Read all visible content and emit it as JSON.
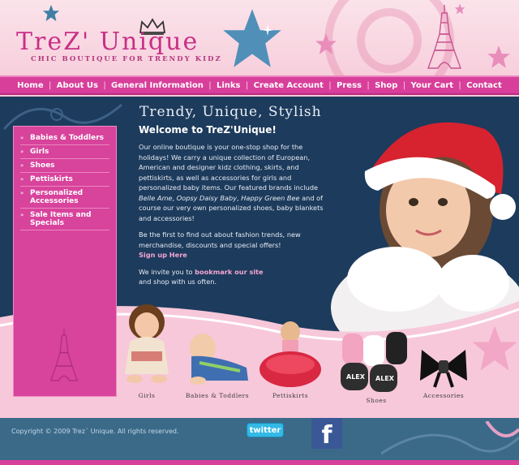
{
  "header": {
    "logo": "TreZ' Unique",
    "tagline": "CHIC BOUTIQUE FOR TRENDY KIDZ"
  },
  "nav": [
    {
      "label": "Home"
    },
    {
      "label": "About Us"
    },
    {
      "label": "General Information"
    },
    {
      "label": "Links"
    },
    {
      "label": "Create Account"
    },
    {
      "label": "Press"
    },
    {
      "label": "Shop"
    },
    {
      "label": "Your Cart"
    },
    {
      "label": "Contact"
    }
  ],
  "sidebar": {
    "items": [
      {
        "label": "Babies & Toddlers"
      },
      {
        "label": "Girls"
      },
      {
        "label": "Shoes"
      },
      {
        "label": "Pettiskirts"
      },
      {
        "label": "Personalized Accessories"
      },
      {
        "label": "Sale Items and Specials"
      }
    ]
  },
  "main": {
    "heading": "Trendy, Unique, Stylish",
    "welcome": "Welcome to TreZ'Unique!",
    "p1_a": "Our online boutique is your one-stop shop for the holidays! We carry a unique collection of European, American and designer kidz clothing, skirts, and pettiskirts, as well as accessories for girls and personalized baby items. Our featured brands include ",
    "brand1": "Belle Ame",
    "brand2": "Oopsy Daisy Baby",
    "brand3": "Happy Green Bee",
    "p1_b": " and of course our very own personalized shoes, baby blankets and accessories!",
    "p2": "Be the first to find out about fashion trends, new merchandise, discounts and special offers!",
    "signup": "Sign up Here",
    "p3_a": "We invite you to ",
    "bookmark": "bookmark our site",
    "p3_b": "and shop with us often."
  },
  "products": [
    {
      "label": "Girls"
    },
    {
      "label": "Babies & Toddlers"
    },
    {
      "label": "Pettiskirts"
    },
    {
      "label": "Shoes"
    },
    {
      "label": "Accessories"
    }
  ],
  "shoe_names": {
    "a": "ALEX",
    "b": "ALEX"
  },
  "footer": {
    "copyright": "Copyright © 2009 Trez´ Unique. All rights reserved.",
    "twitter": "twitter",
    "facebook": "f"
  },
  "colors": {
    "pink": "#d83f9a",
    "navy": "#1d3b5c",
    "steel": "#3b6a89"
  }
}
